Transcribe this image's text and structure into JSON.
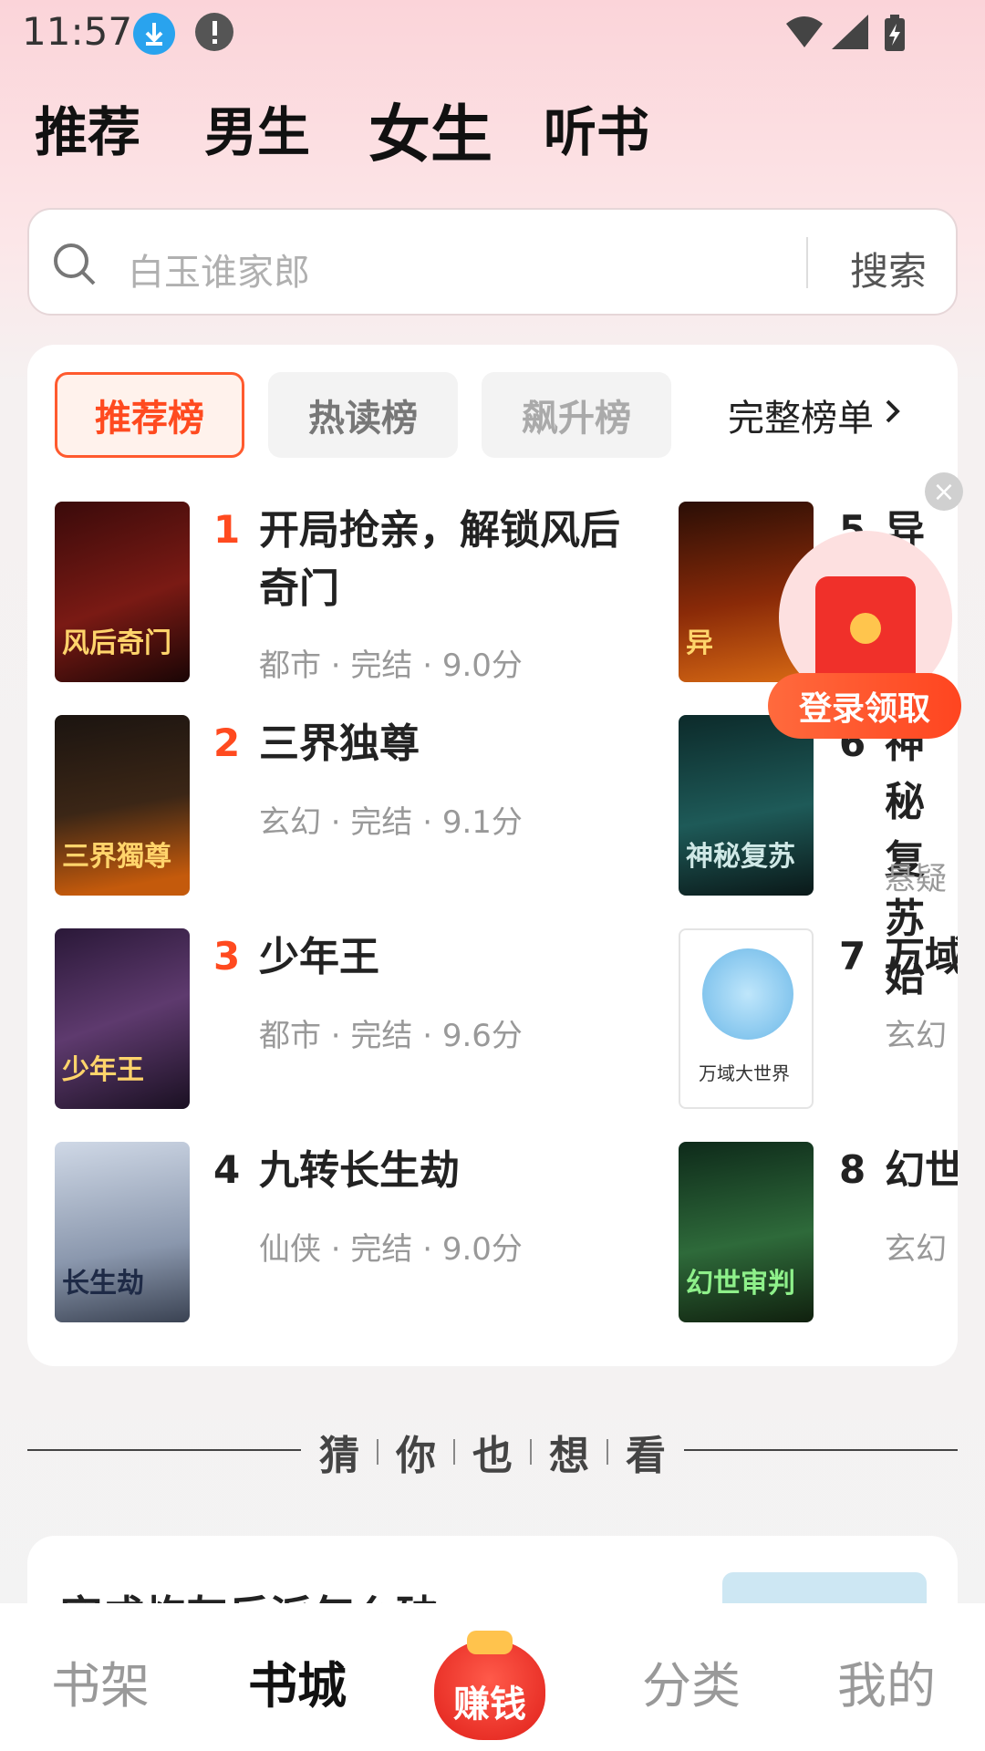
{
  "status_bar": {
    "time": "11:57"
  },
  "top_tabs": [
    "推荐",
    "男生",
    "女生",
    "听书"
  ],
  "active_top_tab": "女生",
  "search": {
    "placeholder": "白玉谁家郎",
    "button": "搜索"
  },
  "rank_tabs": [
    "推荐榜",
    "热读榜",
    "飙升榜"
  ],
  "full_list_label": "完整榜单",
  "books_left": [
    {
      "rank": "1",
      "title": "开局抢亲，解锁风后奇门",
      "meta": "都市 · 完结 · 9.0分",
      "cover_text": "风后奇门"
    },
    {
      "rank": "2",
      "title": "三界独尊",
      "meta": "玄幻 · 完结 · 9.1分",
      "cover_text": "三界獨尊"
    },
    {
      "rank": "3",
      "title": "少年王",
      "meta": "都市 · 完结 · 9.6分",
      "cover_text": "少年王"
    },
    {
      "rank": "4",
      "title": "九转长生劫",
      "meta": "仙侠 · 完结 · 9.0分",
      "cover_text": "长生劫"
    }
  ],
  "books_right": [
    {
      "rank": "5",
      "title": "异",
      "meta": "",
      "cover_text": "异"
    },
    {
      "rank": "6",
      "title": "神秘复苏始",
      "meta": "悬疑",
      "cover_text": "神秘复苏"
    },
    {
      "rank": "7",
      "title": "万域大世界",
      "meta": "玄幻",
      "cover_text": "万域大世界"
    },
    {
      "rank": "8",
      "title": "幻世审判",
      "meta": "玄幻",
      "cover_text": "幻世审判"
    }
  ],
  "promo": {
    "label": "登录领取"
  },
  "guess_section": {
    "chars": [
      "猜",
      "你",
      "也",
      "想",
      "看"
    ]
  },
  "next_card": {
    "title": "穿成炮灰反派怎么破"
  },
  "bottom_nav": {
    "items": [
      "书架",
      "书城",
      "赚钱",
      "分类",
      "我的"
    ],
    "active": "书城"
  },
  "colors": {
    "accent": "#ff4a1f",
    "brand_red": "#f0302a"
  }
}
